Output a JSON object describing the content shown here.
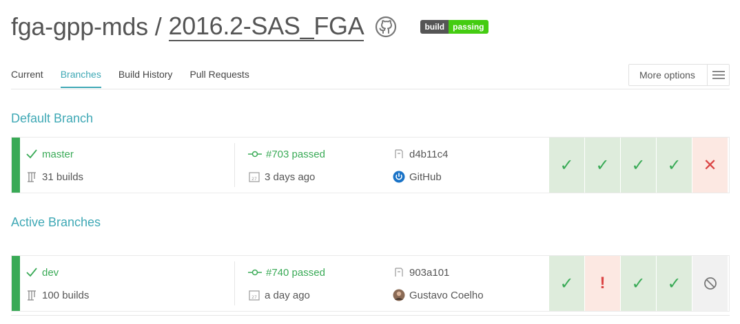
{
  "header": {
    "owner": "fga-gpp-mds",
    "separator": "/",
    "repo": "2016.2-SAS_FGA",
    "badge_left": "build",
    "badge_right": "passing"
  },
  "tabs": [
    {
      "label": "Current"
    },
    {
      "label": "Branches",
      "active": true
    },
    {
      "label": "Build History"
    },
    {
      "label": "Pull Requests"
    }
  ],
  "more_options": {
    "label": "More options"
  },
  "default_section": {
    "title": "Default Branch"
  },
  "active_section": {
    "title": "Active Branches"
  },
  "branches": {
    "master": {
      "name": "master",
      "builds": "31 builds",
      "last_build": "#703 passed",
      "when": "3 days ago",
      "commit": "d4b11c4",
      "author": "GitHub",
      "statuses": [
        "passed",
        "passed",
        "passed",
        "passed",
        "failed"
      ]
    },
    "dev": {
      "name": "dev",
      "builds": "100 builds",
      "last_build": "#740 passed",
      "when": "a day ago",
      "commit": "903a101",
      "author": "Gustavo Coelho",
      "statuses": [
        "passed",
        "errored",
        "passed",
        "passed",
        "canceled"
      ]
    }
  },
  "colors": {
    "accent": "#3ea8b5",
    "passed": "#39aa56",
    "failed": "#db4545",
    "badge_green": "#44cc11"
  }
}
